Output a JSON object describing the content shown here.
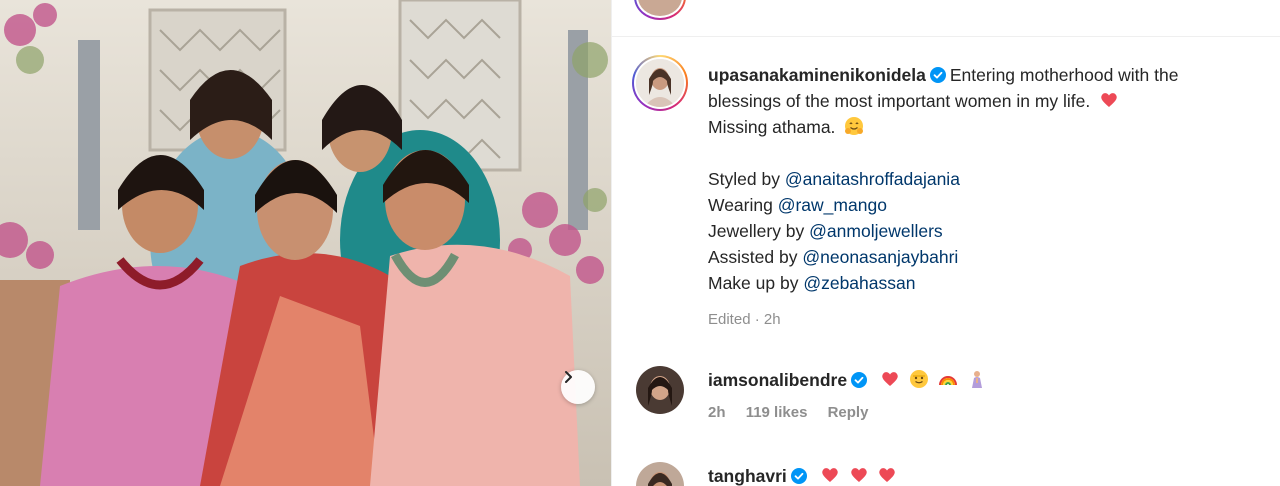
{
  "post": {
    "username": "upasanakaminenikonidela",
    "caption_line1": "Entering motherhood with the",
    "caption_line2": "blessings of the most important women in my life.",
    "caption_line3": "Missing athama.",
    "credits": [
      {
        "prefix": "Styled by ",
        "mention": "@anaitashroffadajania"
      },
      {
        "prefix": "Wearing ",
        "mention": "@raw_mango"
      },
      {
        "prefix": "Jewellery by ",
        "mention": "@anmoljewellers"
      },
      {
        "prefix": "Assisted by ",
        "mention": "@neonasanjaybahri"
      },
      {
        "prefix": "Make up by ",
        "mention": "@zebahassan"
      }
    ],
    "edited": "Edited · 2h"
  },
  "comments": [
    {
      "username": "iamsonalibendre",
      "emojis": [
        "red-heart",
        "smiling-face",
        "rainbow",
        "praying-person"
      ],
      "time": "2h",
      "likes": "119 likes",
      "reply": "Reply"
    },
    {
      "username": "tanghavri",
      "emojis": [
        "red-heart",
        "red-heart",
        "red-heart"
      ]
    }
  ],
  "icons": {
    "verified": "verified-badge-icon",
    "carousel_next": "chevron-right-icon"
  },
  "colors": {
    "verified_blue": "#0095f6",
    "mention_blue": "#00376b",
    "heart_red": "#ed4956",
    "meta_grey": "#8e8e8e"
  }
}
